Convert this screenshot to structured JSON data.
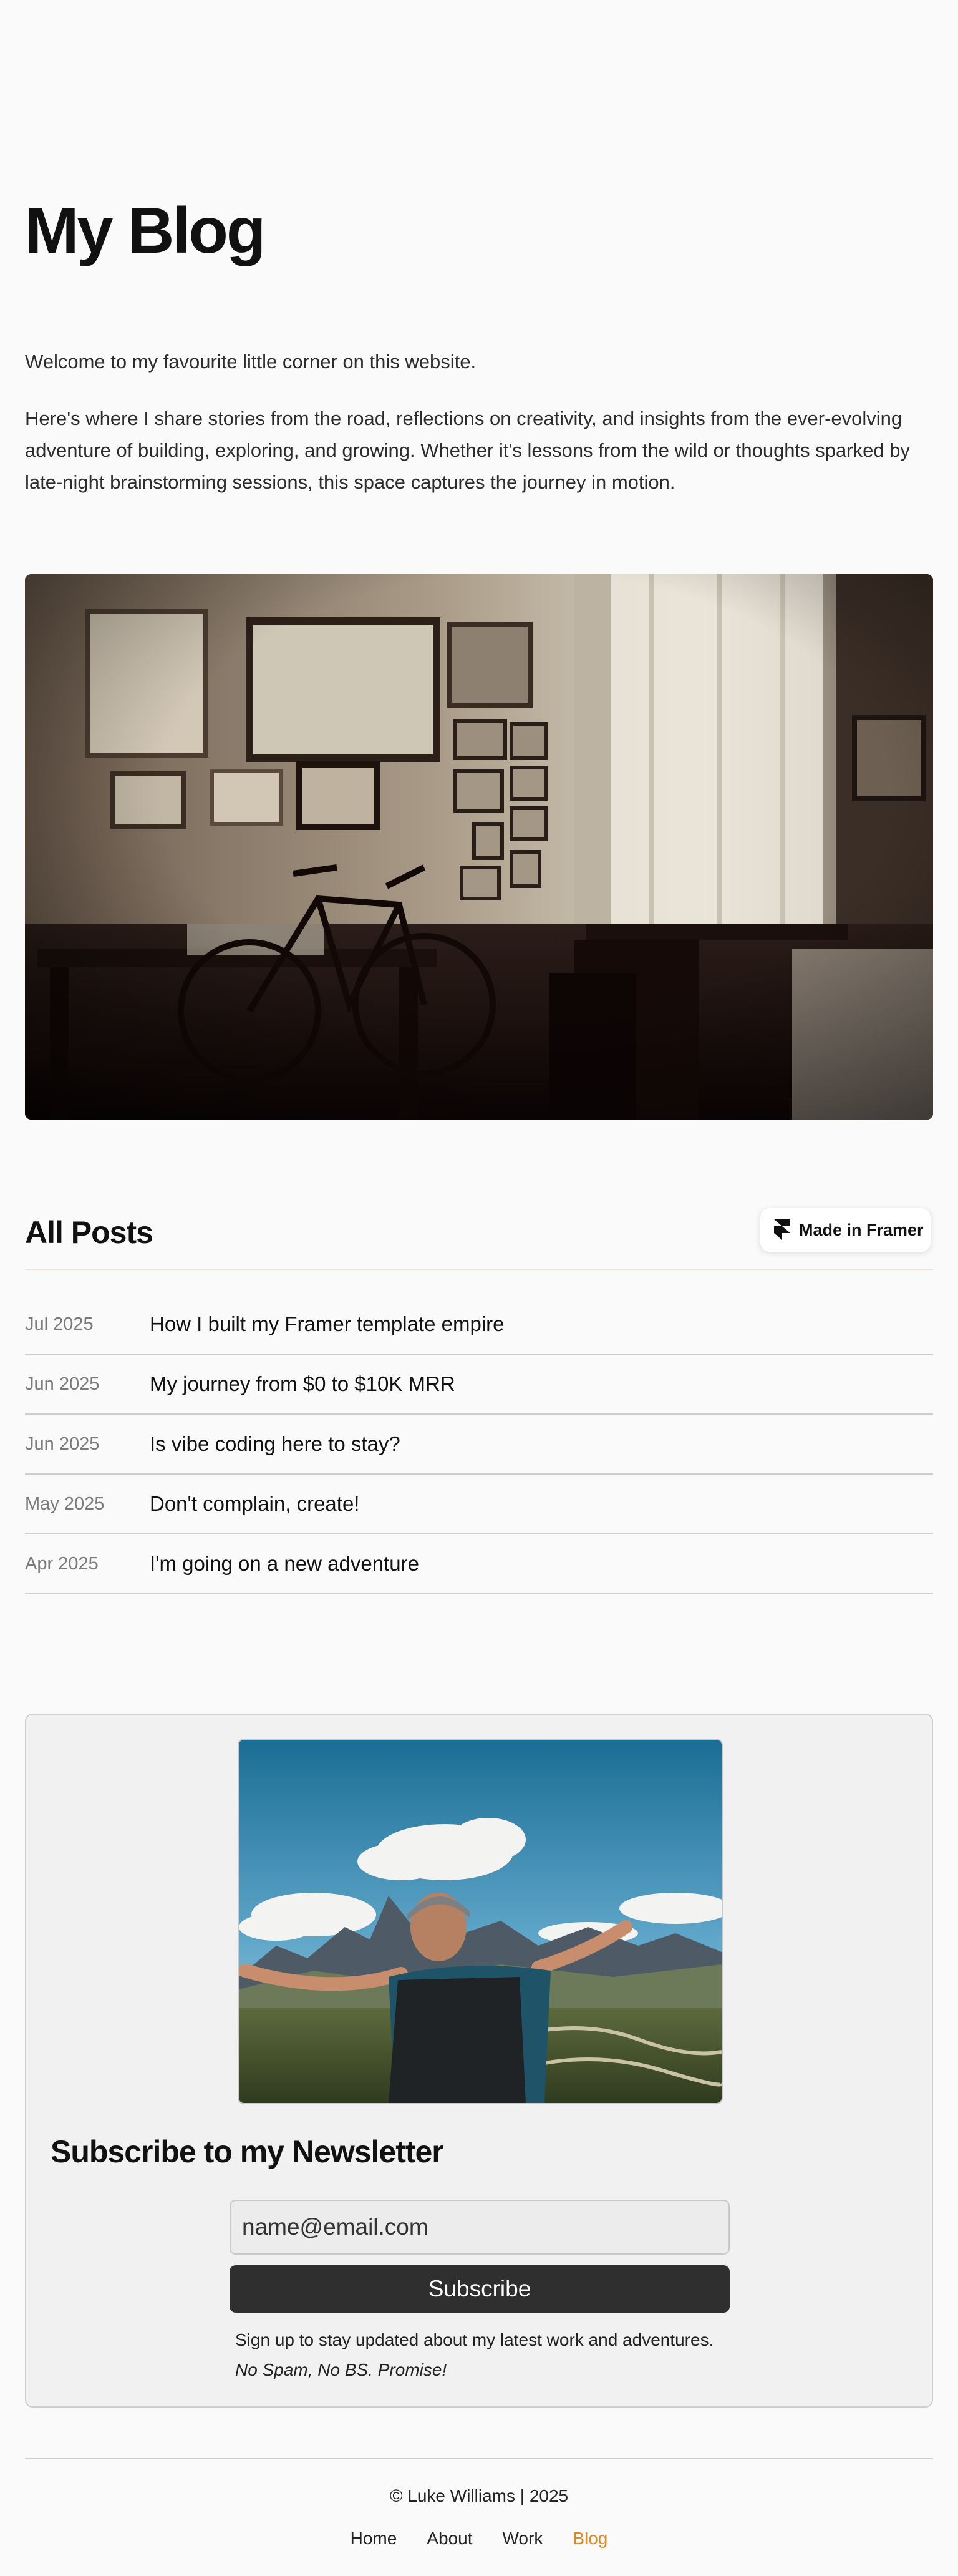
{
  "hero": {
    "title": "My Blog",
    "intro_1": "Welcome to my favourite little corner on this website.",
    "intro_2": "Here's where I share stories from the road, reflections on creativity, and insights from the ever-evolving adventure of building, exploring, and growing. Whether it's lessons from the wild or thoughts sparked by late-night brainstorming sessions, this space captures the journey in motion."
  },
  "posts": {
    "title": "All Posts",
    "items": [
      {
        "date": "Jul 2025",
        "title": "How I built my Framer template empire"
      },
      {
        "date": "Jun 2025",
        "title": "My journey from $0 to $10K MRR"
      },
      {
        "date": "Jun 2025",
        "title": "Is vibe coding here to stay?"
      },
      {
        "date": "May 2025",
        "title": "Don't complain, create!"
      },
      {
        "date": "Apr 2025",
        "title": "I'm going on a new adventure"
      }
    ]
  },
  "badge": {
    "label": "Made in Framer",
    "icon": "framer-logo-icon"
  },
  "newsletter": {
    "title": "Subscribe to my Newsletter",
    "placeholder": "name@email.com",
    "button": "Subscribe",
    "note": "Sign up to stay updated about my latest work and adventures.",
    "promise": "No Spam, No BS. Promise!"
  },
  "footer": {
    "copyright": "© Luke Williams | 2025",
    "nav": [
      {
        "label": "Home"
      },
      {
        "label": "About"
      },
      {
        "label": "Work"
      },
      {
        "label": "Blog"
      }
    ]
  },
  "colors": {
    "accent": "#e08a1e",
    "button": "#2f2f2f",
    "background": "#fafafa"
  }
}
